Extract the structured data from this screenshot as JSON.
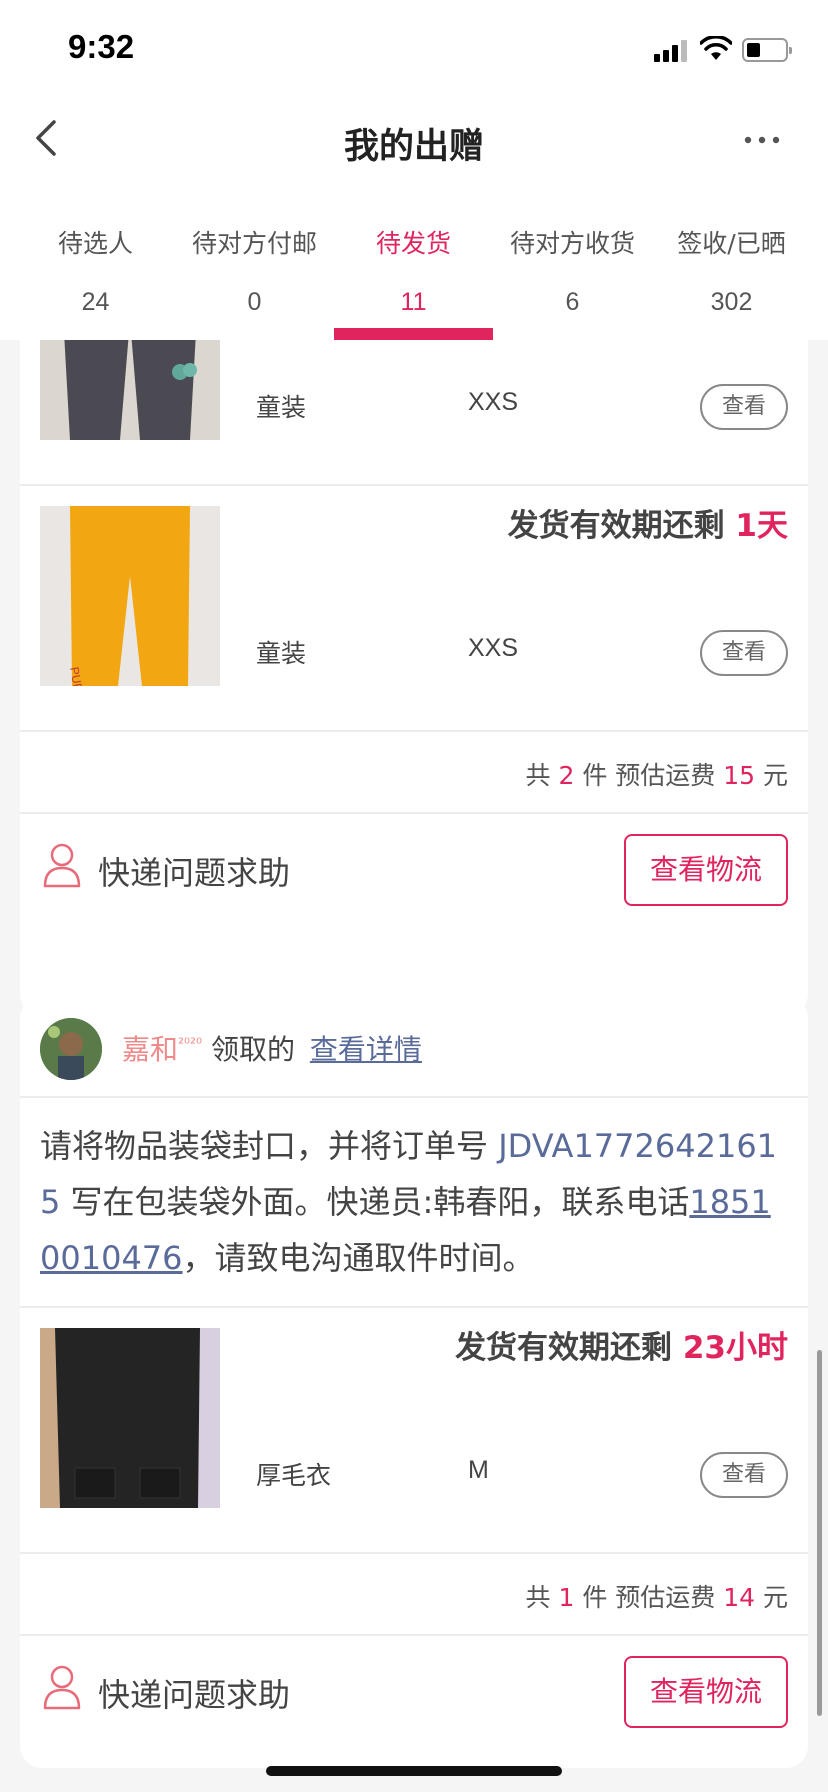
{
  "status": {
    "time": "9:32"
  },
  "nav": {
    "title": "我的出赠"
  },
  "tabs": [
    {
      "label": "待选人",
      "count": "24"
    },
    {
      "label": "待对方付邮",
      "count": "0"
    },
    {
      "label": "待发货",
      "count": "11",
      "active": true
    },
    {
      "label": "待对方收货",
      "count": "6"
    },
    {
      "label": "签收/已晒",
      "count": "302"
    }
  ],
  "orders": [
    {
      "items": [
        {
          "category": "童装",
          "size": "XXS",
          "view_label": "查看"
        },
        {
          "deadline_prefix": "发货有效期还剩 ",
          "deadline_value": "1天",
          "category": "童装",
          "size": "XXS",
          "view_label": "查看"
        }
      ],
      "summary": {
        "total_prefix": "共 ",
        "count": "2",
        "count_suffix": " 件 预估运费 ",
        "fee": "15",
        "fee_suffix": " 元"
      },
      "help": {
        "label": "快递问题求助",
        "logistics_label": "查看物流"
      }
    },
    {
      "receiver": {
        "name": "嘉和",
        "name_sup": "²⁰²⁰",
        "received_label": " 领取的 ",
        "detail_link": "查看详情"
      },
      "instruction": {
        "part1": "请将物品装袋封口，并将订单号 ",
        "order_no": "JDVA17726421615",
        "part2": " 写在包装袋外面。快递员:韩春阳，联系电话",
        "phone": "18510010476",
        "part3": "，请致电沟通取件时间。"
      },
      "items": [
        {
          "deadline_prefix": "发货有效期还剩 ",
          "deadline_value": "23小时",
          "category": "厚毛衣",
          "size": "M",
          "view_label": "查看"
        }
      ],
      "summary": {
        "total_prefix": "共 ",
        "count": "1",
        "count_suffix": " 件 预估运费 ",
        "fee": "14",
        "fee_suffix": " 元"
      },
      "help": {
        "label": "快递问题求助",
        "logistics_label": "查看物流"
      }
    }
  ],
  "colors": {
    "accent": "#e0245e",
    "link": "#5a6b9a",
    "background": "#f5f5f5"
  }
}
